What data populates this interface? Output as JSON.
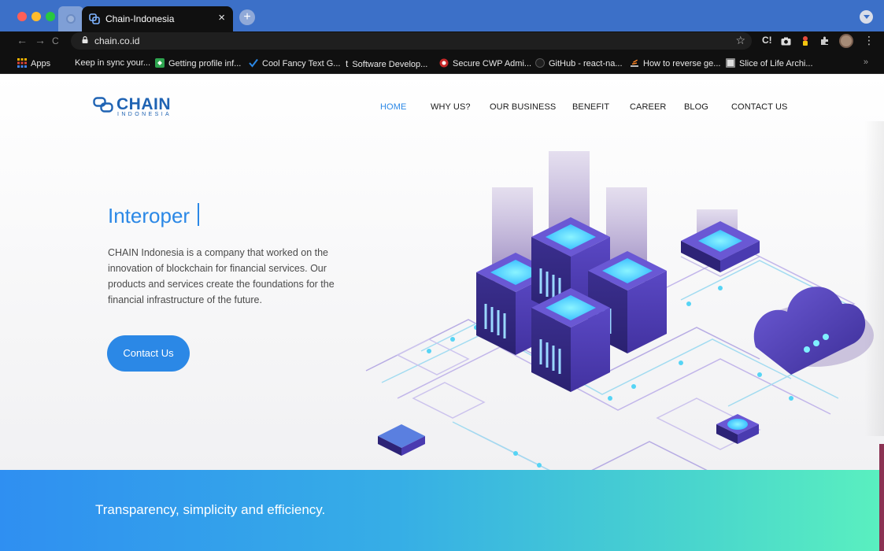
{
  "browser": {
    "tab_title": "Chain-Indonesia",
    "tab_close": "×",
    "new_tab": "+",
    "url": "chain.co.id",
    "star": "☆",
    "ext_label": "C!",
    "nav_back": "←",
    "nav_forward": "→",
    "nav_reload": "C",
    "more": "⋮",
    "bookmarks": [
      {
        "label": "Apps",
        "icon": "apps-grid-icon",
        "color": "#f4b400"
      },
      {
        "label": "Keep in sync your...",
        "icon": "none"
      },
      {
        "label": "Getting profile inf...",
        "icon": "site-icon",
        "color": "#2ea44f"
      },
      {
        "label": "Cool Fancy Text G...",
        "icon": "checkmark-icon",
        "color": "#2b88e6"
      },
      {
        "label": "Software Develop...",
        "icon": "tumblr-icon"
      },
      {
        "label": "Secure CWP Admi...",
        "icon": "cwp-icon",
        "color": "#c62828"
      },
      {
        "label": "GitHub - react-na...",
        "icon": "github-icon"
      },
      {
        "label": "How to reverse ge...",
        "icon": "stackoverflow-icon",
        "color": "#f48024"
      },
      {
        "label": "Slice of Life Archi...",
        "icon": "site-icon",
        "color": "#888888"
      }
    ],
    "bookmarks_more": "»"
  },
  "site": {
    "logo_word": "CHAIN",
    "logo_sub": "INDONESIA",
    "nav": [
      {
        "label": "HOME",
        "active": true
      },
      {
        "label": "WHY US?"
      },
      {
        "label": "OUR BUSINESS"
      },
      {
        "label": "BENEFIT"
      },
      {
        "label": "CAREER"
      },
      {
        "label": "BLOG"
      },
      {
        "label": "CONTACT US"
      }
    ],
    "hero_title": "Interoper",
    "hero_text": "CHAIN Indonesia is a company that worked on the innovation of blockchain for financial services. Our products and services create the foundations for the financial infrastructure of the future.",
    "cta_label": "Contact Us",
    "band_text": "Transparency, simplicity and efficiency.",
    "colors": {
      "accent": "#2b88e6",
      "brand_dark": "#1f63b3",
      "band_start": "#2f8ff1",
      "band_end": "#5af0bf"
    }
  }
}
